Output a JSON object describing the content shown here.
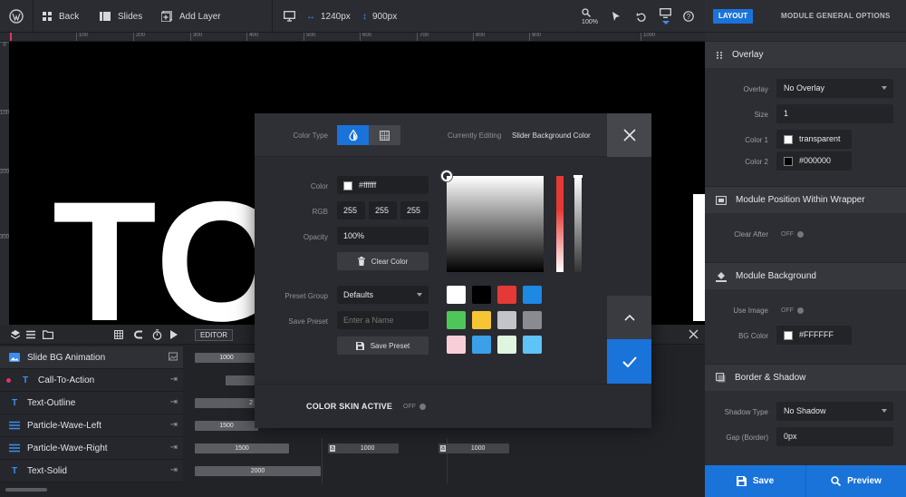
{
  "topbar": {
    "back_label": "Back",
    "slides_label": "Slides",
    "add_layer_label": "Add Layer",
    "width_value": "1240px",
    "height_value": "900px",
    "zoom_label": "100%"
  },
  "ruler": {
    "top_ticks": [
      "100",
      "200",
      "300",
      "400",
      "500",
      "600",
      "700",
      "800",
      "900",
      "1000"
    ],
    "left_ticks": [
      "0",
      "100",
      "200",
      "300"
    ]
  },
  "canvas": {
    "big_text": "TO"
  },
  "timeline": {
    "editor_label": "EDITOR",
    "layers": [
      {
        "name": "Slide BG Animation",
        "icon": "image-icon"
      },
      {
        "name": "Call-To-Action",
        "icon": "text-icon"
      },
      {
        "name": "Text-Outline",
        "icon": "text-icon"
      },
      {
        "name": "Particle-Wave-Left",
        "icon": "particles-icon"
      },
      {
        "name": "Particle-Wave-Right",
        "icon": "particles-icon"
      },
      {
        "name": "Text-Solid",
        "icon": "text-icon"
      }
    ],
    "tracks": [
      "1000",
      "",
      "2",
      "1500",
      "1500",
      "2000"
    ],
    "tracks_extra": [
      "1000",
      "1000"
    ],
    "text_icon_glyph": "T",
    "anim_marker": "a"
  },
  "modal": {
    "color_type_label": "Color Type",
    "currently_editing_label": "Currently Editing",
    "currently_editing_value": "Slider Background Color",
    "color_label": "Color",
    "color_value": "#ffffff",
    "rgb_label": "RGB",
    "rgb": [
      "255",
      "255",
      "255"
    ],
    "opacity_label": "Opacity",
    "opacity_value": "100%",
    "clear_color_label": "Clear Color",
    "preset_group_label": "Preset Group",
    "preset_group_value": "Defaults",
    "save_preset_label": "Save Preset",
    "preset_name_placeholder": "Enter a Name",
    "save_preset_button": "Save Preset",
    "skin_label": "COLOR SKIN ACTIVE",
    "skin_toggle": "OFF",
    "presets": [
      "#ffffff",
      "#000000",
      "#e53935",
      "#1e88e5",
      "#4fc65a",
      "#f7c534",
      "#c3c4c8",
      "#8a8b90",
      "#f8cfd9",
      "#3aa0e8",
      "#dff5df",
      "#5ec3f5"
    ]
  },
  "panel": {
    "layout_tab": "LAYOUT",
    "title": "MODULE GENERAL OPTIONS",
    "overlay_title": "Overlay",
    "overlay_label": "Overlay",
    "overlay_value": "No Overlay",
    "size_label": "Size",
    "size_value": "1",
    "color1_label": "Color 1",
    "color1_value": "transparent",
    "color2_label": "Color 2",
    "color2_value": "#000000",
    "position_title": "Module Position Within Wrapper",
    "clear_after_label": "Clear After",
    "clear_after_value": "OFF",
    "background_title": "Module Background",
    "use_image_label": "Use Image",
    "use_image_value": "OFF",
    "bg_color_label": "BG Color",
    "bg_color_value": "#FFFFFF",
    "border_title": "Border & Shadow",
    "shadow_type_label": "Shadow Type",
    "shadow_type_value": "No Shadow",
    "gap_label": "Gap (Border)",
    "gap_value": "0px",
    "save_label": "Save",
    "preview_label": "Preview"
  },
  "colors": {
    "accent": "#1a73d9"
  }
}
